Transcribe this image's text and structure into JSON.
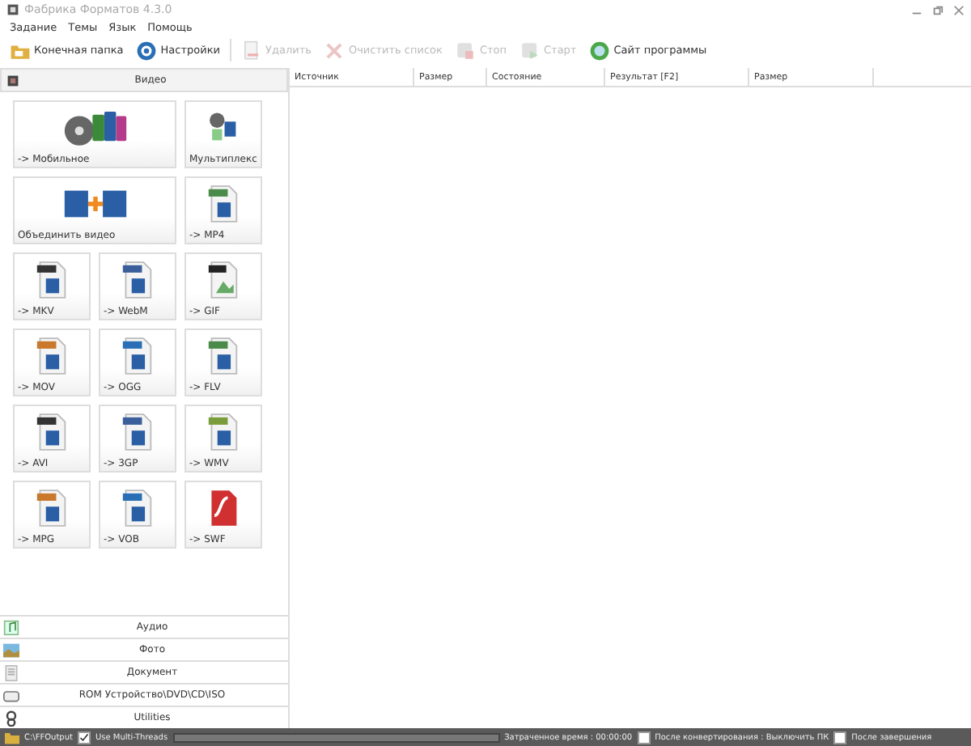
{
  "window": {
    "title": "Фабрика Форматов 4.3.0"
  },
  "menu": [
    "Задание",
    "Темы",
    "Язык",
    "Помощь"
  ],
  "toolbar": [
    {
      "label": "Конечная папка",
      "kind": "folder",
      "disabled": false
    },
    {
      "label": "Настройки",
      "kind": "settings",
      "disabled": false
    },
    {
      "label": "Удалить",
      "kind": "delete",
      "disabled": true
    },
    {
      "label": "Очистить список",
      "kind": "clear",
      "disabled": true
    },
    {
      "label": "Стоп",
      "kind": "stop",
      "disabled": true
    },
    {
      "label": "Старт",
      "kind": "start",
      "disabled": true
    },
    {
      "label": "Сайт программы",
      "kind": "web",
      "disabled": false
    }
  ],
  "sidebar": {
    "header": "Видео",
    "tiles": [
      {
        "label": "-> Мобильное",
        "kind": "mobile",
        "wide": true
      },
      {
        "label": "Мультиплекс",
        "kind": "mux",
        "wide": false
      },
      {
        "label": "Объединить видео",
        "kind": "join",
        "wide": true
      },
      {
        "label": "-> MP4",
        "kind": "file",
        "wide": false
      },
      {
        "label": "-> MKV",
        "kind": "file",
        "wide": false
      },
      {
        "label": "-> WebM",
        "kind": "file",
        "wide": false
      },
      {
        "label": "-> GIF",
        "kind": "image",
        "wide": false
      },
      {
        "label": "-> MOV",
        "kind": "file",
        "wide": false
      },
      {
        "label": "-> OGG",
        "kind": "file",
        "wide": false
      },
      {
        "label": "-> FLV",
        "kind": "file",
        "wide": false
      },
      {
        "label": "-> AVI",
        "kind": "file",
        "wide": false
      },
      {
        "label": "-> 3GP",
        "kind": "file",
        "wide": false
      },
      {
        "label": "-> WMV",
        "kind": "file",
        "wide": false
      },
      {
        "label": "-> MPG",
        "kind": "file",
        "wide": false
      },
      {
        "label": "-> VOB",
        "kind": "file",
        "wide": false
      },
      {
        "label": "-> SWF",
        "kind": "flash",
        "wide": false
      }
    ],
    "categories": [
      {
        "label": "Аудио",
        "kind": "audio"
      },
      {
        "label": "Фото",
        "kind": "photo"
      },
      {
        "label": "Документ",
        "kind": "document"
      },
      {
        "label": "ROM Устройство\\DVD\\CD\\ISO",
        "kind": "disc"
      },
      {
        "label": "Utilities",
        "kind": "utilities"
      }
    ]
  },
  "table": {
    "columns": [
      "Источник",
      "Размер",
      "Состояние",
      "Результат [F2]",
      "Размер"
    ]
  },
  "status_bar": {
    "folder": "C:\\FFOutput",
    "progress": {
      "level": 0
    },
    "multithread": {
      "label": "Use Multi-Threads",
      "checked": true
    },
    "elapsed": "Затраченное время : 00:00:00",
    "options": [
      {
        "label": "После конвертирования : Выключить ПК",
        "checked": false
      },
      {
        "label": "После завершения",
        "checked": false
      }
    ]
  }
}
